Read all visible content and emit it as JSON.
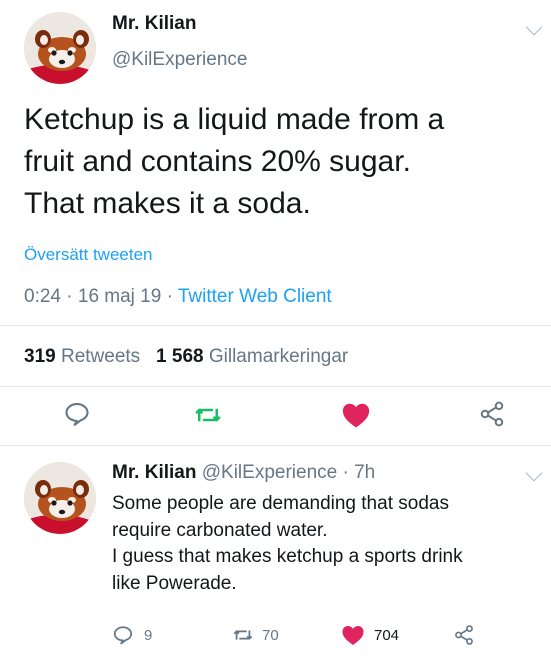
{
  "tweet": {
    "author_name": "Mr. Kilian",
    "author_handle": "@KilExperience",
    "text_lines": [
      "Ketchup is a liquid made from a",
      "fruit and contains 20% sugar.",
      "That makes it a soda."
    ],
    "translate_label": "Översätt tweeten",
    "time": "0:24",
    "date": "16 maj 19",
    "client": "Twitter Web Client",
    "retweets_count": "319",
    "retweets_label": "Retweets",
    "likes_count": "1 568",
    "likes_label": "Gillamarkeringar",
    "separator": "·"
  },
  "reply": {
    "author_name": "Mr. Kilian",
    "author_handle": "@KilExperience",
    "age": "7h",
    "separator": "·",
    "text_lines": [
      "Some people are demanding that sodas",
      "require carbonated water.",
      "I guess that makes ketchup a sports drink",
      "like Powerade."
    ],
    "reply_count": "9",
    "retweet_count": "70",
    "like_count": "704"
  },
  "colors": {
    "link": "#1da1f2",
    "retweet": "#17bf63",
    "like": "#e0245e",
    "secondary": "#657786"
  },
  "icons": {
    "reply": "speech-bubble-icon",
    "retweet": "retweet-arrows-icon",
    "like": "heart-icon",
    "share": "share-nodes-icon",
    "menu": "chevron-down-icon"
  }
}
